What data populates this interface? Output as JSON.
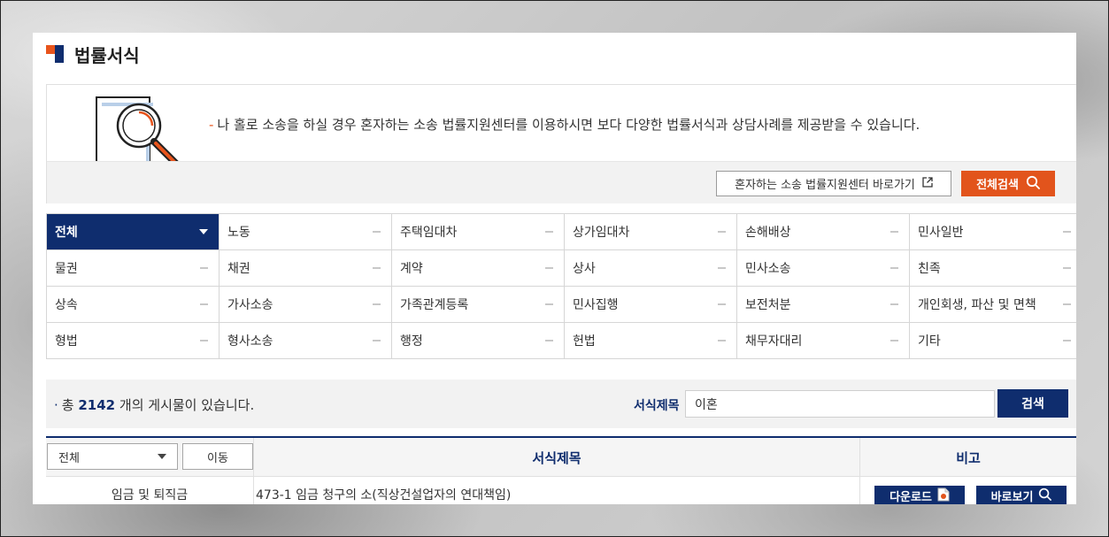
{
  "page": {
    "title": "법률서식"
  },
  "info": {
    "dash": "-",
    "text": "나 홀로 소송을 하실 경우 혼자하는 소송 법률지원센터를 이용하시면 보다 다양한 법률서식과 상담사례를 제공받을 수 있습니다.",
    "center_link_label": "혼자하는 소송 법률지원센터 바로가기",
    "search_all_label": "전체검색"
  },
  "categories": [
    {
      "label": "전체",
      "active": true
    },
    {
      "label": "노동"
    },
    {
      "label": "주택임대차"
    },
    {
      "label": "상가임대차"
    },
    {
      "label": "손해배상"
    },
    {
      "label": "민사일반"
    },
    {
      "label": "물권"
    },
    {
      "label": "채권"
    },
    {
      "label": "계약"
    },
    {
      "label": "상사"
    },
    {
      "label": "민사소송"
    },
    {
      "label": "친족"
    },
    {
      "label": "상속"
    },
    {
      "label": "가사소송"
    },
    {
      "label": "가족관계등록"
    },
    {
      "label": "민사집행"
    },
    {
      "label": "보전처분"
    },
    {
      "label": "개인회생, 파산 및 면책"
    },
    {
      "label": "형법"
    },
    {
      "label": "형사소송"
    },
    {
      "label": "행정"
    },
    {
      "label": "헌법"
    },
    {
      "label": "채무자대리"
    },
    {
      "label": "기타"
    }
  ],
  "search": {
    "count_prefix": "총",
    "count": "2142",
    "count_suffix": "개의 게시물이 있습니다.",
    "field_label": "서식제목",
    "query": "이혼",
    "button_label": "검색"
  },
  "table": {
    "filter_value": "전체",
    "move_label": "이동",
    "col_title": "서식제목",
    "col_note": "비고",
    "rows": [
      {
        "category": "임금 및 퇴직금",
        "title": "473-1 임금 청구의 소(직상건설업자의 연대책임)",
        "download_label": "다운로드",
        "view_label": "바로보기"
      }
    ]
  },
  "colors": {
    "navy": "#0f2d6e",
    "orange": "#e2541c"
  }
}
